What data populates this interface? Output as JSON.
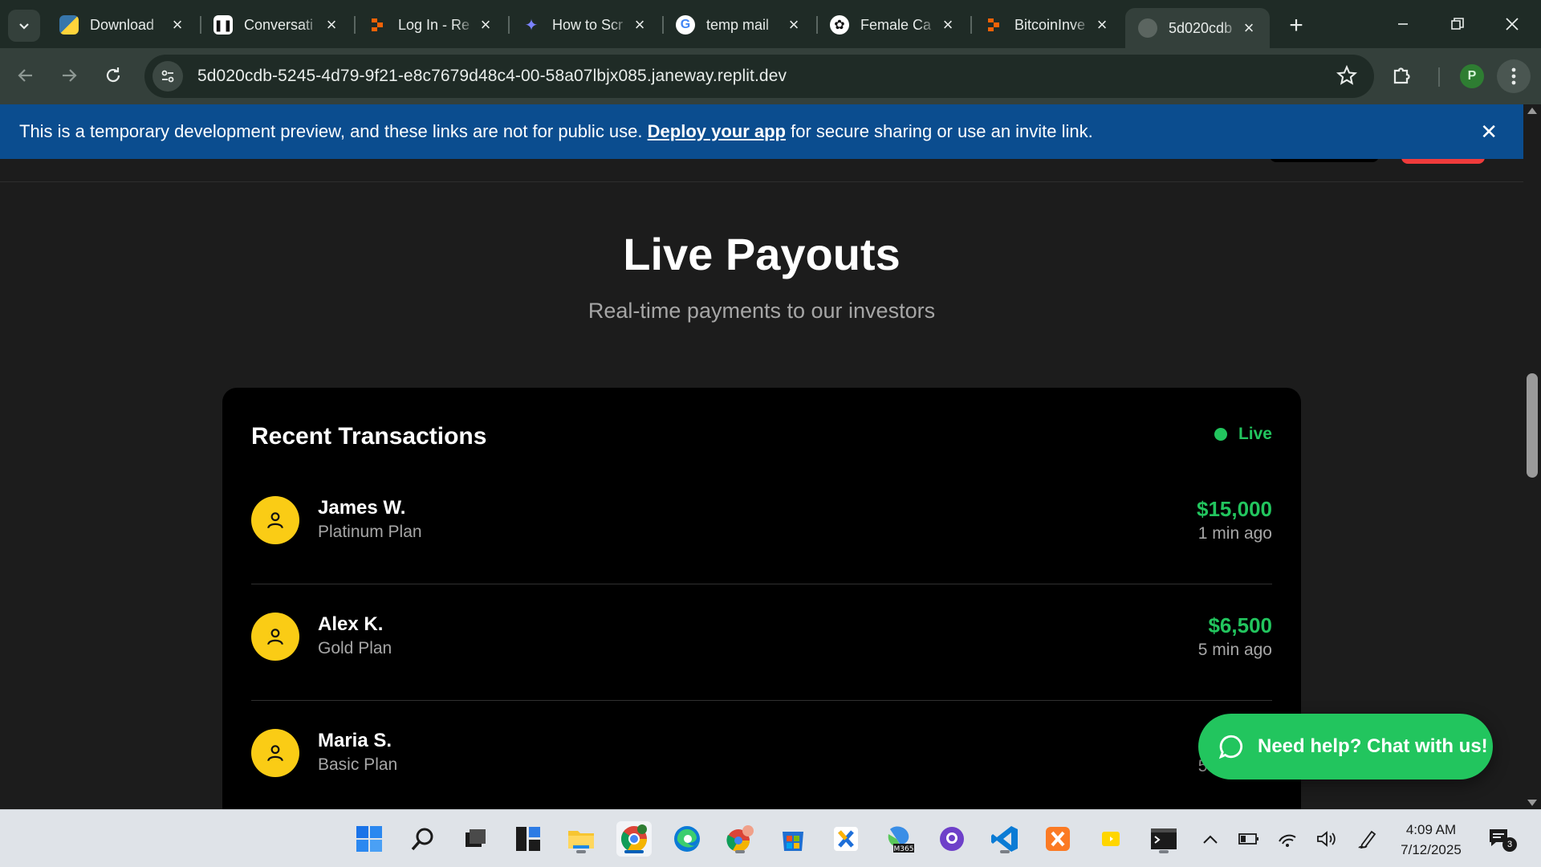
{
  "browser": {
    "tabs": [
      {
        "title": "Download",
        "favicon": "python-icon"
      },
      {
        "title": "Conversati",
        "favicon": "pause-icon"
      },
      {
        "title": "Log In - Re",
        "favicon": "replit-icon"
      },
      {
        "title": "How to Scr",
        "favicon": "bird-icon"
      },
      {
        "title": "temp mail",
        "favicon": "google-icon"
      },
      {
        "title": "Female Ca",
        "favicon": "openai-icon"
      },
      {
        "title": "BitcoinInve",
        "favicon": "replit-icon"
      },
      {
        "title": "5d020cdb",
        "favicon": "globe-icon",
        "active": true
      }
    ],
    "address_bar": {
      "url": "5d020cdb-5245-4d79-9f21-e8c7679d48c4-00-58a07lbjx085.janeway.replit.dev"
    },
    "profile_initial": "P"
  },
  "banner": {
    "text_before": "This is a temporary development preview, and these links are not for public use.",
    "link_label": "Deploy your app",
    "text_after": "for secure sharing or use an invite link."
  },
  "section": {
    "title": "Live Payouts",
    "subtitle": "Real-time payments to our investors"
  },
  "transactions_card": {
    "title": "Recent Transactions",
    "live_label": "Live",
    "items": [
      {
        "name": "James W.",
        "plan": "Platinum Plan",
        "amount": "$15,000",
        "time": "1 min ago"
      },
      {
        "name": "Alex K.",
        "plan": "Gold Plan",
        "amount": "$6,500",
        "time": "5 min ago"
      },
      {
        "name": "Maria S.",
        "plan": "Basic Plan",
        "amount": "",
        "time": "5 min ago"
      }
    ]
  },
  "chat_button": {
    "label": "Need help? Chat with us!"
  },
  "colors": {
    "accent_green": "#22c55e",
    "avatar_yellow": "#facc15",
    "banner_blue": "#0b4d8f"
  },
  "taskbar": {
    "apps": [
      "windows-start-icon",
      "search-icon",
      "task-view-icon",
      "widgets-icon",
      "file-explorer-icon",
      "chrome-icon",
      "edge-icon",
      "chrome-profile-icon",
      "store-icon",
      "xampp-icon",
      "m365-icon",
      "github-desktop-icon",
      "vscode-icon",
      "xampp-control-icon",
      "sticky-icon",
      "terminal-icon"
    ],
    "clock": {
      "time": "4:09 AM",
      "date": "7/12/2025"
    },
    "notification_count": "3"
  }
}
